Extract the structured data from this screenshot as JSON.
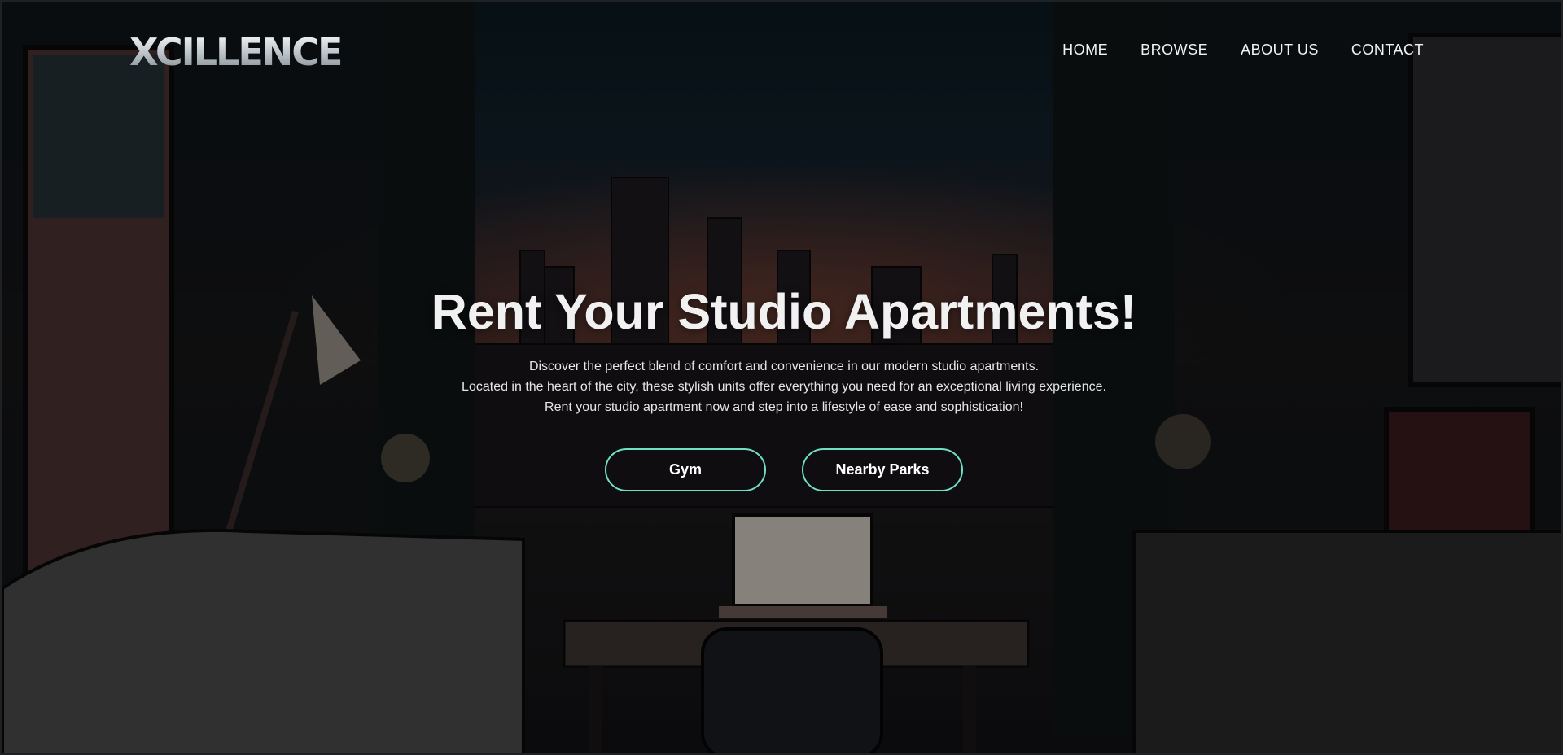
{
  "brand": {
    "logo": "XCILLENCE"
  },
  "nav": {
    "items": [
      "HOME",
      "BROWSE",
      "ABOUT US",
      "CONTACT"
    ]
  },
  "hero": {
    "title": "Rent Your Studio Apartments!",
    "lines": [
      "Discover the perfect blend of comfort and convenience in our modern studio apartments.",
      "Located in the heart of the city, these stylish units offer everything you need for an exceptional living experience.",
      "Rent your studio apartment now and step into a lifestyle of ease and sophistication!"
    ],
    "buttons": [
      "Gym",
      "Nearby Parks"
    ]
  },
  "colors": {
    "button_border": "#6fe0c4",
    "text": "#f1f1f1"
  }
}
